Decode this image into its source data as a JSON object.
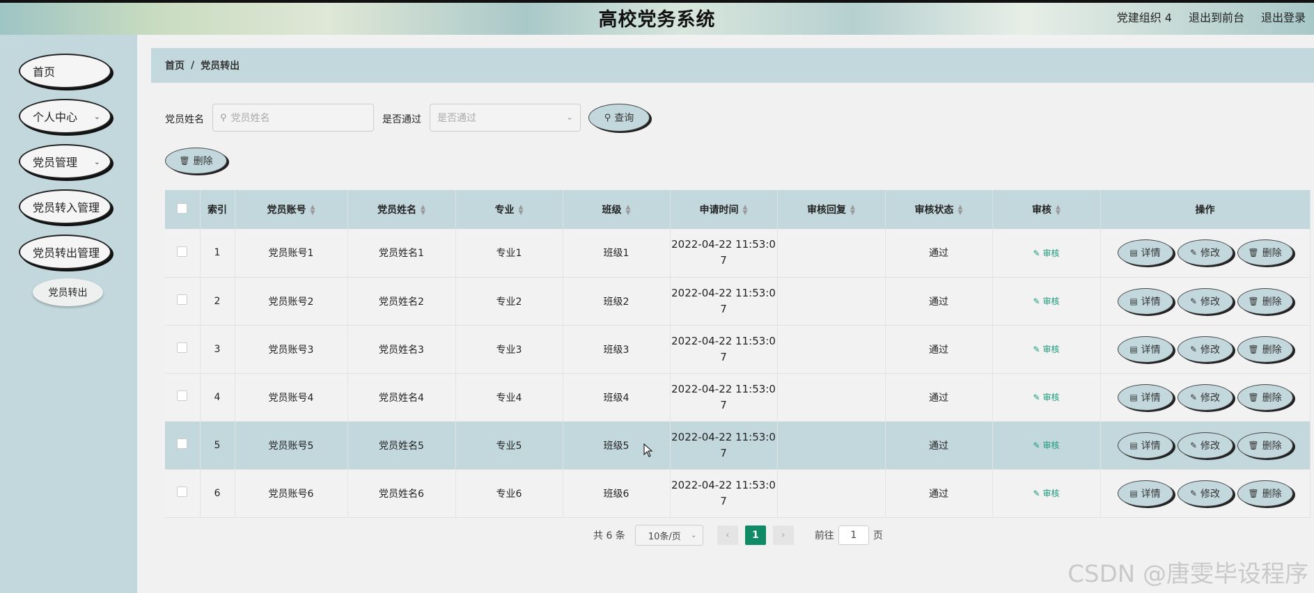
{
  "app": {
    "title": "高校党务系统",
    "top_links": [
      "党建组织 4",
      "退出到前台",
      "退出登录"
    ]
  },
  "sidebar": {
    "items": [
      {
        "label": "首页",
        "has_chevron": false
      },
      {
        "label": "个人中心",
        "has_chevron": true
      },
      {
        "label": "党员管理",
        "has_chevron": true
      },
      {
        "label": "党员转入管理",
        "has_chevron": false
      },
      {
        "label": "党员转出管理",
        "has_chevron": false
      }
    ],
    "sub_item": "党员转出"
  },
  "breadcrumb": {
    "home": "首页",
    "separator": "/",
    "current": "党员转出"
  },
  "search": {
    "name_label": "党员姓名",
    "name_placeholder": "党员姓名",
    "pass_label": "是否通过",
    "pass_placeholder": "是否通过",
    "query_button": "查询",
    "delete_button": "删除"
  },
  "table": {
    "headers": [
      "索引",
      "党员账号",
      "党员姓名",
      "专业",
      "班级",
      "申请时间",
      "审核回复",
      "审核状态",
      "审核",
      "操作"
    ],
    "rows": [
      {
        "index": "1",
        "account": "党员账号1",
        "name": "党员姓名1",
        "major": "专业1",
        "class": "班级1",
        "time_line1": "2022-04-22 11:53:0",
        "time_line2": "7",
        "reply": "",
        "status": "通过",
        "audit": "审核"
      },
      {
        "index": "2",
        "account": "党员账号2",
        "name": "党员姓名2",
        "major": "专业2",
        "class": "班级2",
        "time_line1": "2022-04-22 11:53:0",
        "time_line2": "7",
        "reply": "",
        "status": "通过",
        "audit": "审核"
      },
      {
        "index": "3",
        "account": "党员账号3",
        "name": "党员姓名3",
        "major": "专业3",
        "class": "班级3",
        "time_line1": "2022-04-22 11:53:0",
        "time_line2": "7",
        "reply": "",
        "status": "通过",
        "audit": "审核"
      },
      {
        "index": "4",
        "account": "党员账号4",
        "name": "党员姓名4",
        "major": "专业4",
        "class": "班级4",
        "time_line1": "2022-04-22 11:53:0",
        "time_line2": "7",
        "reply": "",
        "status": "通过",
        "audit": "审核"
      },
      {
        "index": "5",
        "account": "党员账号5",
        "name": "党员姓名5",
        "major": "专业5",
        "class": "班级5",
        "time_line1": "2022-04-22 11:53:0",
        "time_line2": "7",
        "reply": "",
        "status": "通过",
        "audit": "审核"
      },
      {
        "index": "6",
        "account": "党员账号6",
        "name": "党员姓名6",
        "major": "专业6",
        "class": "班级6",
        "time_line1": "2022-04-22 11:53:0",
        "time_line2": "7",
        "reply": "",
        "status": "通过",
        "audit": "审核"
      }
    ],
    "highlighted_row": 5,
    "actions": {
      "detail": "详情",
      "edit": "修改",
      "delete": "删除"
    }
  },
  "pagination": {
    "total_text": "共 6 条",
    "page_size": "10条/页",
    "current_page": "1",
    "goto_label": "前往",
    "goto_value": "1",
    "page_suffix": "页"
  },
  "watermark": "CSDN @唐雯毕设程序",
  "colors": {
    "accent": "#c2d8dd",
    "active_page": "#0f8a65",
    "audit_link": "#1a9a7a"
  }
}
